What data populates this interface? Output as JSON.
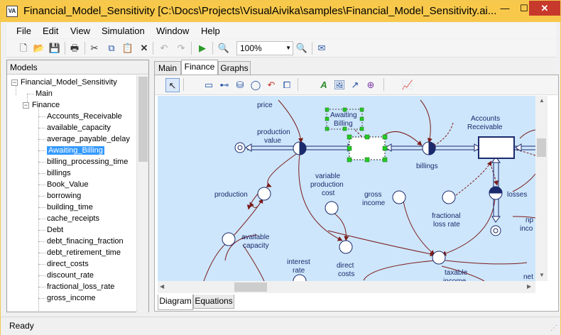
{
  "window": {
    "title": "Financial_Model_Sensitivity [C:\\Docs\\Projects\\VisualAivika\\samples\\Financial_Model_Sensitivity.ai...",
    "app_icon": "VA",
    "min": "—",
    "max": "☐",
    "close": "✕"
  },
  "menu": [
    "File",
    "Edit",
    "View",
    "Simulation",
    "Window",
    "Help"
  ],
  "toolbar": {
    "zoom": "100%"
  },
  "models": {
    "header": "Models",
    "root": "Financial_Model_Sensitivity",
    "main": "Main",
    "finance": "Finance",
    "items": [
      "Accounts_Receivable",
      "available_capacity",
      "average_payable_delay",
      "Awaiting_Billing",
      "billing_processing_time",
      "billings",
      "Book_Value",
      "borrowing",
      "building_time",
      "cache_receipts",
      "Debt",
      "debt_finacing_fraction",
      "debt_retirement_time",
      "direct_costs",
      "discount_rate",
      "fractional_loss_rate",
      "gross_income"
    ],
    "selected_index": 3
  },
  "tabs": [
    "Main",
    "Finance",
    "Graphs"
  ],
  "bottom_tabs": [
    "Diagram",
    "Equations"
  ],
  "diagram": {
    "labels": {
      "price": "price",
      "production_value": [
        "production",
        "value"
      ],
      "awaiting_billing": [
        "Awaiting",
        "Billing"
      ],
      "accounts_receivable": [
        "Accounts",
        "Receivable"
      ],
      "billings": "billings",
      "variable_production_cost": [
        "variable",
        "production",
        "cost"
      ],
      "production": "production",
      "gross_income": [
        "gross",
        "income"
      ],
      "losses": "losses",
      "fractional_loss_rate": [
        "fractional",
        "loss rate"
      ],
      "available_capacity": [
        "available",
        "capacity"
      ],
      "np_inco": [
        "np",
        "inco"
      ],
      "interest_rate": [
        "interest",
        "rate"
      ],
      "direct_costs": [
        "direct",
        "costs"
      ],
      "taxable_income": [
        "taxable",
        "income"
      ],
      "net": "net"
    }
  },
  "status": "Ready"
}
